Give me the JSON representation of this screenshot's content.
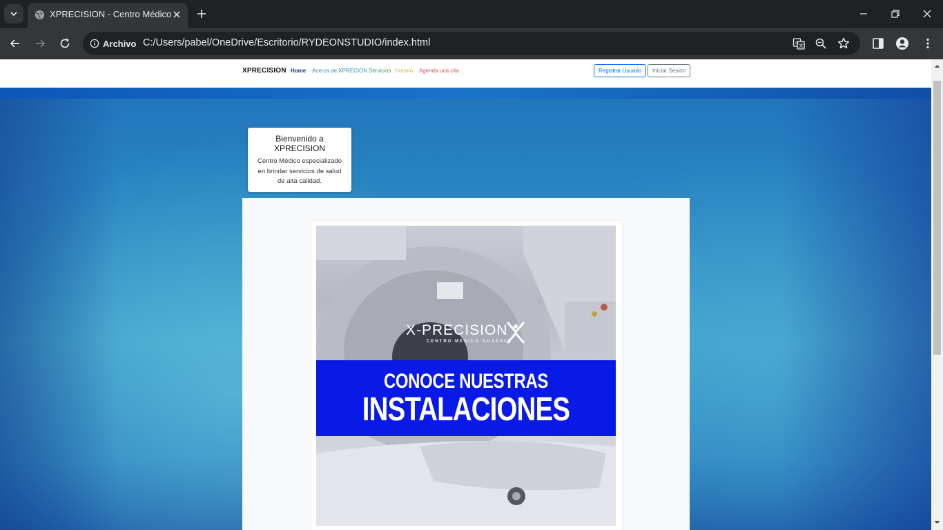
{
  "browser": {
    "tab_title": "XPRECISION - Centro Médico",
    "site_chip": "Archivo",
    "url": "C:/Users/pabel/OneDrive/Escritorio/RYDEONSTUDIO/index.html"
  },
  "navbar": {
    "brand": "XPRECISION",
    "links": [
      {
        "label": "Home",
        "color": "#0d3b8a"
      },
      {
        "label": "Acerca de XPRECION",
        "color": "#2a8fb8"
      },
      {
        "label": "Servicios",
        "color": "#3a9e5a"
      },
      {
        "label": "Horario",
        "color": "#e8b03a"
      },
      {
        "label": "Agenda una cita",
        "color": "#d9534f"
      }
    ],
    "register_label": "Registrar Usuario",
    "login_label": "Iniciar Sesión"
  },
  "welcome": {
    "title": "Bienvenido a XPRECISION",
    "text": "Centro Médico especializado en brindar servicios de salud de alta calidad."
  },
  "promo": {
    "logo_text": "X-PRECISION",
    "logo_subtext": "CENTRO MEDICO GUASAVE",
    "line1": "CONOCE NUESTRAS",
    "line2": "INSTALACIONES",
    "band_color": "#0a1ae6"
  }
}
